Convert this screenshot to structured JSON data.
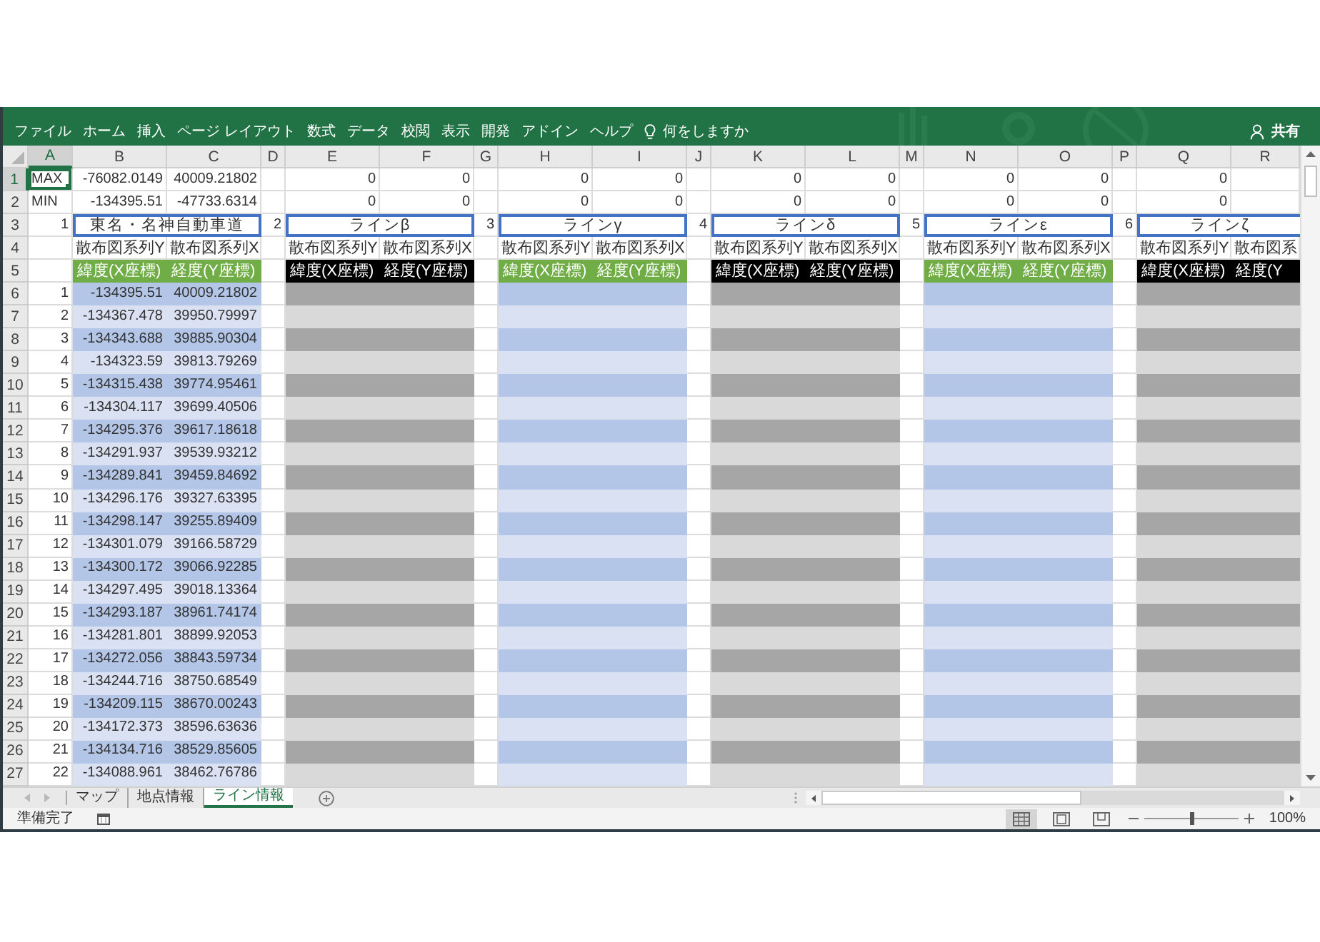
{
  "ribbon": {
    "tabs": [
      "ファイル",
      "ホーム",
      "挿入",
      "ページ レイアウト",
      "数式",
      "データ",
      "校閲",
      "表示",
      "開発",
      "アドイン",
      "ヘルプ"
    ],
    "tell_me": "何をしますか",
    "share": "共有"
  },
  "sheet": {
    "column_headers": [
      {
        "label": "A",
        "selected": true
      },
      {
        "label": "B",
        "selected": false
      },
      {
        "label": "C",
        "selected": false
      },
      {
        "label": "D",
        "selected": false
      },
      {
        "label": "E",
        "selected": false
      },
      {
        "label": "F",
        "selected": false
      },
      {
        "label": "G",
        "selected": false
      },
      {
        "label": "H",
        "selected": false
      },
      {
        "label": "I",
        "selected": false
      },
      {
        "label": "J",
        "selected": false
      },
      {
        "label": "K",
        "selected": false
      },
      {
        "label": "L",
        "selected": false
      },
      {
        "label": "M",
        "selected": false
      },
      {
        "label": "N",
        "selected": false
      },
      {
        "label": "O",
        "selected": false
      },
      {
        "label": "P",
        "selected": false
      },
      {
        "label": "Q",
        "selected": false
      },
      {
        "label": "R",
        "selected": false
      }
    ],
    "row_headers": [
      {
        "label": "1",
        "selected": true
      },
      {
        "label": "2",
        "selected": false
      },
      {
        "label": "3",
        "selected": false
      },
      {
        "label": "4",
        "selected": false
      },
      {
        "label": "5",
        "selected": false
      },
      {
        "label": "6",
        "selected": false
      },
      {
        "label": "7",
        "selected": false
      },
      {
        "label": "8",
        "selected": false
      },
      {
        "label": "9",
        "selected": false
      },
      {
        "label": "10",
        "selected": false
      },
      {
        "label": "11",
        "selected": false
      },
      {
        "label": "12",
        "selected": false
      },
      {
        "label": "13",
        "selected": false
      },
      {
        "label": "14",
        "selected": false
      },
      {
        "label": "15",
        "selected": false
      },
      {
        "label": "16",
        "selected": false
      },
      {
        "label": "17",
        "selected": false
      },
      {
        "label": "18",
        "selected": false
      },
      {
        "label": "19",
        "selected": false
      },
      {
        "label": "20",
        "selected": false
      },
      {
        "label": "21",
        "selected": false
      },
      {
        "label": "22",
        "selected": false
      },
      {
        "label": "23",
        "selected": false
      },
      {
        "label": "24",
        "selected": false
      },
      {
        "label": "25",
        "selected": false
      },
      {
        "label": "26",
        "selected": false
      },
      {
        "label": "27",
        "selected": false
      }
    ],
    "summary_labels": [
      {
        "label": "MAX",
        "selected": true
      },
      {
        "label": "MIN",
        "selected": false
      }
    ],
    "lines": [
      {
        "number": "1",
        "name": "東名・名神自動車道",
        "color": "#70ad47",
        "bands": [
          {
            "color": "#b4c6e7"
          },
          {
            "color": "#d9e1f2"
          }
        ],
        "columns": [
          {
            "summary": [
              "-76082.0149",
              "-134395.51"
            ],
            "series_label": "散布図系列Y",
            "header": "緯度(X座標)"
          },
          {
            "summary": [
              "40009.21802",
              "-47733.6314"
            ],
            "series_label": "散布図系列X",
            "header": "経度(Y座標)"
          }
        ],
        "points": [
          {
            "number": "1",
            "values": [
              "-134395.51",
              "40009.21802"
            ]
          },
          {
            "number": "2",
            "values": [
              "-134367.478",
              "39950.79997"
            ]
          },
          {
            "number": "3",
            "values": [
              "-134343.688",
              "39885.90304"
            ]
          },
          {
            "number": "4",
            "values": [
              "-134323.59",
              "39813.79269"
            ]
          },
          {
            "number": "5",
            "values": [
              "-134315.438",
              "39774.95461"
            ]
          },
          {
            "number": "6",
            "values": [
              "-134304.117",
              "39699.40506"
            ]
          },
          {
            "number": "7",
            "values": [
              "-134295.376",
              "39617.18618"
            ]
          },
          {
            "number": "8",
            "values": [
              "-134291.937",
              "39539.93212"
            ]
          },
          {
            "number": "9",
            "values": [
              "-134289.841",
              "39459.84692"
            ]
          },
          {
            "number": "10",
            "values": [
              "-134296.176",
              "39327.63395"
            ]
          },
          {
            "number": "11",
            "values": [
              "-134298.147",
              "39255.89409"
            ]
          },
          {
            "number": "12",
            "values": [
              "-134301.079",
              "39166.58729"
            ]
          },
          {
            "number": "13",
            "values": [
              "-134300.172",
              "39066.92285"
            ]
          },
          {
            "number": "14",
            "values": [
              "-134297.495",
              "39018.13364"
            ]
          },
          {
            "number": "15",
            "values": [
              "-134293.187",
              "38961.74174"
            ]
          },
          {
            "number": "16",
            "values": [
              "-134281.801",
              "38899.92053"
            ]
          },
          {
            "number": "17",
            "values": [
              "-134272.056",
              "38843.59734"
            ]
          },
          {
            "number": "18",
            "values": [
              "-134244.716",
              "38750.68549"
            ]
          },
          {
            "number": "19",
            "values": [
              "-134209.115",
              "38670.00243"
            ]
          },
          {
            "number": "20",
            "values": [
              "-134172.373",
              "38596.63636"
            ]
          },
          {
            "number": "21",
            "values": [
              "-134134.716",
              "38529.85605"
            ]
          },
          {
            "number": "22",
            "values": [
              "-134088.961",
              "38462.76786"
            ]
          }
        ]
      },
      {
        "number": "2",
        "name": "ラインβ",
        "color": "#000000",
        "bands": [
          {
            "color": "#a6a6a6"
          },
          {
            "color": "#d9d9d9"
          }
        ],
        "columns": [
          {
            "summary": [
              "0",
              "0"
            ],
            "series_label": "散布図系列Y",
            "header": "緯度(X座標)"
          },
          {
            "summary": [
              "0",
              "0"
            ],
            "series_label": "散布図系列X",
            "header": "経度(Y座標)"
          }
        ]
      },
      {
        "number": "3",
        "name": "ラインγ",
        "color": "#70ad47",
        "bands": [
          {
            "color": "#b4c6e7"
          },
          {
            "color": "#d9e1f2"
          }
        ],
        "columns": [
          {
            "summary": [
              "0",
              "0"
            ],
            "series_label": "散布図系列Y",
            "header": "緯度(X座標)"
          },
          {
            "summary": [
              "0",
              "0"
            ],
            "series_label": "散布図系列X",
            "header": "経度(Y座標)"
          }
        ]
      },
      {
        "number": "4",
        "name": "ラインδ",
        "color": "#000000",
        "bands": [
          {
            "color": "#a6a6a6"
          },
          {
            "color": "#d9d9d9"
          }
        ],
        "columns": [
          {
            "summary": [
              "0",
              "0"
            ],
            "series_label": "散布図系列Y",
            "header": "緯度(X座標)"
          },
          {
            "summary": [
              "0",
              "0"
            ],
            "series_label": "散布図系列X",
            "header": "経度(Y座標)"
          }
        ]
      },
      {
        "number": "5",
        "name": "ラインε",
        "color": "#70ad47",
        "bands": [
          {
            "color": "#b4c6e7"
          },
          {
            "color": "#d9e1f2"
          }
        ],
        "columns": [
          {
            "summary": [
              "0",
              "0"
            ],
            "series_label": "散布図系列Y",
            "header": "緯度(X座標)"
          },
          {
            "summary": [
              "0",
              "0"
            ],
            "series_label": "散布図系列X",
            "header": "経度(Y座標)"
          }
        ]
      },
      {
        "number": "6",
        "name": "ラインζ",
        "color": "#000000",
        "bands": [
          {
            "color": "#a6a6a6"
          },
          {
            "color": "#d9d9d9"
          }
        ],
        "columns": [
          {
            "summary": [
              "0",
              "0"
            ],
            "series_label": "散布図系列Y",
            "header": "緯度(X座標)"
          },
          {
            "series_label": "散布図系",
            "header": "経度(Y"
          }
        ]
      }
    ]
  },
  "sheet_tabs": [
    {
      "label": "マップ",
      "selected": false
    },
    {
      "label": "地点情報",
      "selected": false
    },
    {
      "label": "ライン情報",
      "selected": true
    }
  ],
  "status_bar": {
    "status": "準備完了",
    "view_buttons": [
      {
        "kind": "normal",
        "selected": true
      },
      {
        "kind": "page_layout",
        "selected": false
      },
      {
        "kind": "page_break",
        "selected": false
      }
    ],
    "zoom_slider": {
      "level": 0.5
    },
    "zoom": "100%"
  }
}
